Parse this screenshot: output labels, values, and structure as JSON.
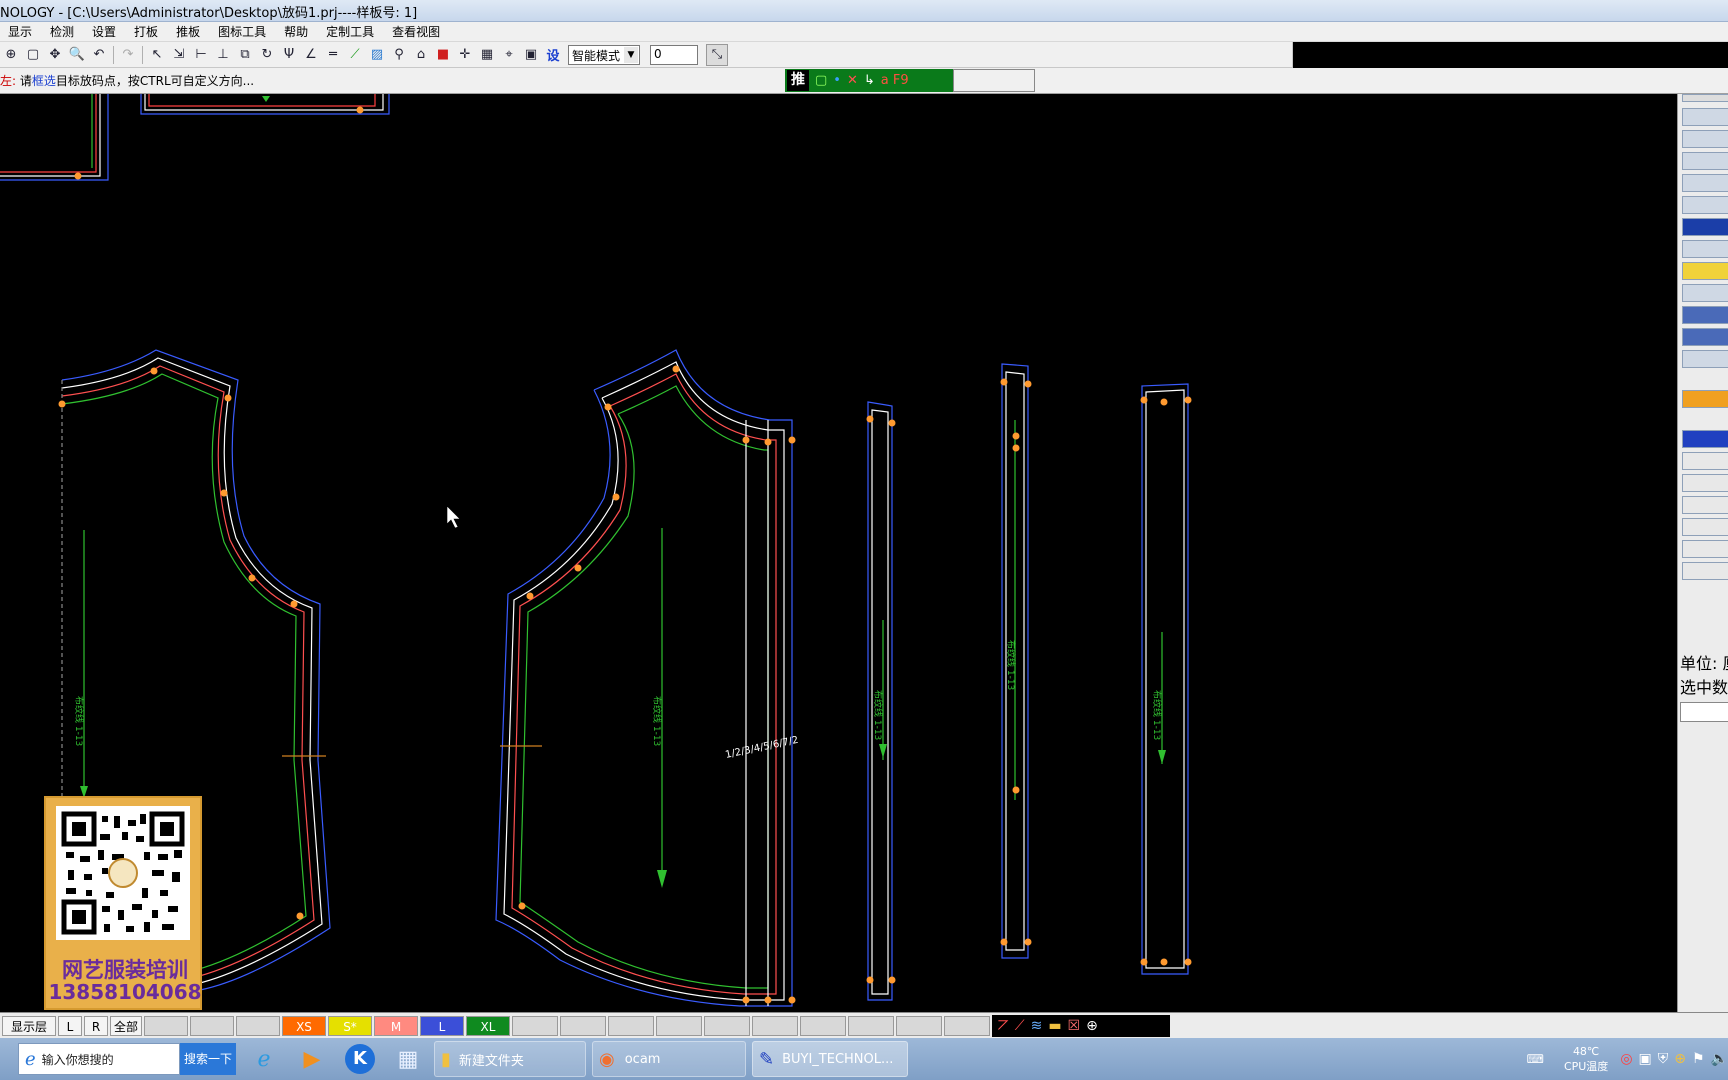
{
  "window": {
    "title": "NOLOGY - [C:\\Users\\Administrator\\Desktop\\放码1.prj----样板号: 1]"
  },
  "menu": [
    "显示",
    "检测",
    "设置",
    "打板",
    "推板",
    "图标工具",
    "帮助",
    "定制工具",
    "查看视图"
  ],
  "toolbar": {
    "mode_select": "智能模式",
    "value_input": "0",
    "settings_label": "设"
  },
  "status": {
    "prefix": "左:",
    "text_a": "请",
    "text_b": "框选",
    "text_c": "目标放码点，按CTRL可自定义方向...",
    "push_label": "推",
    "f9_label": "a F9"
  },
  "right_panel": {
    "unit_label": "单位: 厘",
    "selected_label": "选中数"
  },
  "bottom_bar": {
    "layer_label": "显示层",
    "l_label": "L",
    "r_label": "R",
    "all_label": "全部",
    "sizes": [
      {
        "label": "XS",
        "color": "#ff6a00"
      },
      {
        "label": "S*",
        "color": "#e5e000"
      },
      {
        "label": "M",
        "color": "#ff8a80"
      },
      {
        "label": "L",
        "color": "#3b4fd8"
      },
      {
        "label": "XL",
        "color": "#0f8a1f"
      }
    ]
  },
  "piece_labels": {
    "grain_text": "布纹线 1-13",
    "notch_text": "1/2/3/4/5/6/7/2"
  },
  "promo": {
    "line1": "网艺服装培训",
    "line2": "13858104068"
  },
  "taskbar": {
    "search_placeholder": "输入你想搜的",
    "search_button": "搜索一下",
    "tasks": [
      "新建文件夹",
      "ocam",
      "BUYI_TECHNOL..."
    ],
    "temp": "48℃",
    "cpu_label": "CPU温度"
  }
}
